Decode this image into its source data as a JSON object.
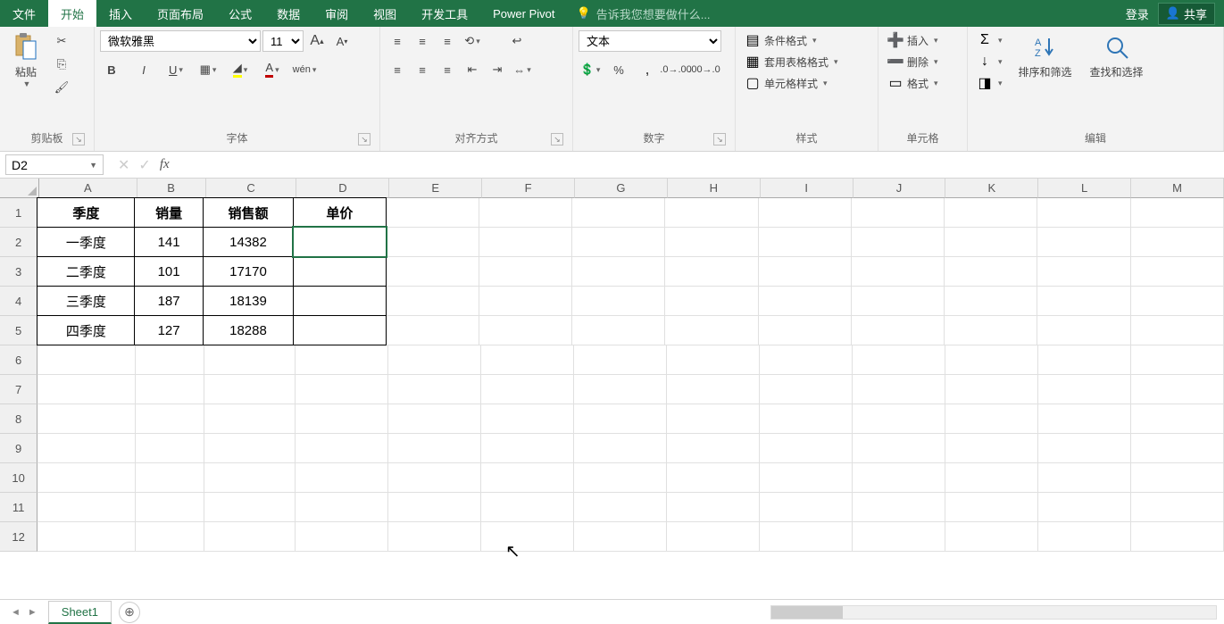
{
  "menu": {
    "tabs": [
      "文件",
      "开始",
      "插入",
      "页面布局",
      "公式",
      "数据",
      "审阅",
      "视图",
      "开发工具",
      "Power Pivot"
    ],
    "active_index": 1,
    "tell_me_placeholder": "告诉我您想要做什么...",
    "login": "登录",
    "share": "共享"
  },
  "ribbon": {
    "clipboard": {
      "label": "剪贴板",
      "paste": "粘贴"
    },
    "font": {
      "label": "字体",
      "name": "微软雅黑",
      "size": "11",
      "bold": "B",
      "italic": "I",
      "underline": "U",
      "phonetic": "wén"
    },
    "alignment": {
      "label": "对齐方式"
    },
    "number": {
      "label": "数字",
      "format": "文本"
    },
    "styles": {
      "label": "样式",
      "conditional": "条件格式",
      "format_table": "套用表格格式",
      "cell_styles": "单元格样式"
    },
    "cells": {
      "label": "单元格",
      "insert": "插入",
      "delete": "删除",
      "format": "格式"
    },
    "editing": {
      "label": "编辑",
      "sort": "排序和筛选",
      "find": "查找和选择"
    }
  },
  "formula_bar": {
    "name_box": "D2",
    "fx": "fx",
    "formula": ""
  },
  "grid": {
    "columns": [
      "A",
      "B",
      "C",
      "D",
      "E",
      "F",
      "G",
      "H",
      "I",
      "J",
      "K",
      "L",
      "M"
    ],
    "row_count": 12,
    "selected_cell": "D2",
    "headers": {
      "A": "季度",
      "B": "销量",
      "C": "销售额",
      "D": "单价"
    },
    "data": [
      {
        "A": "一季度",
        "B": "141",
        "C": "14382",
        "D": ""
      },
      {
        "A": "二季度",
        "B": "101",
        "C": "17170",
        "D": ""
      },
      {
        "A": "三季度",
        "B": "187",
        "C": "18139",
        "D": ""
      },
      {
        "A": "四季度",
        "B": "127",
        "C": "18288",
        "D": ""
      }
    ]
  },
  "sheet": {
    "tabs": [
      "Sheet1"
    ],
    "active": "Sheet1"
  }
}
